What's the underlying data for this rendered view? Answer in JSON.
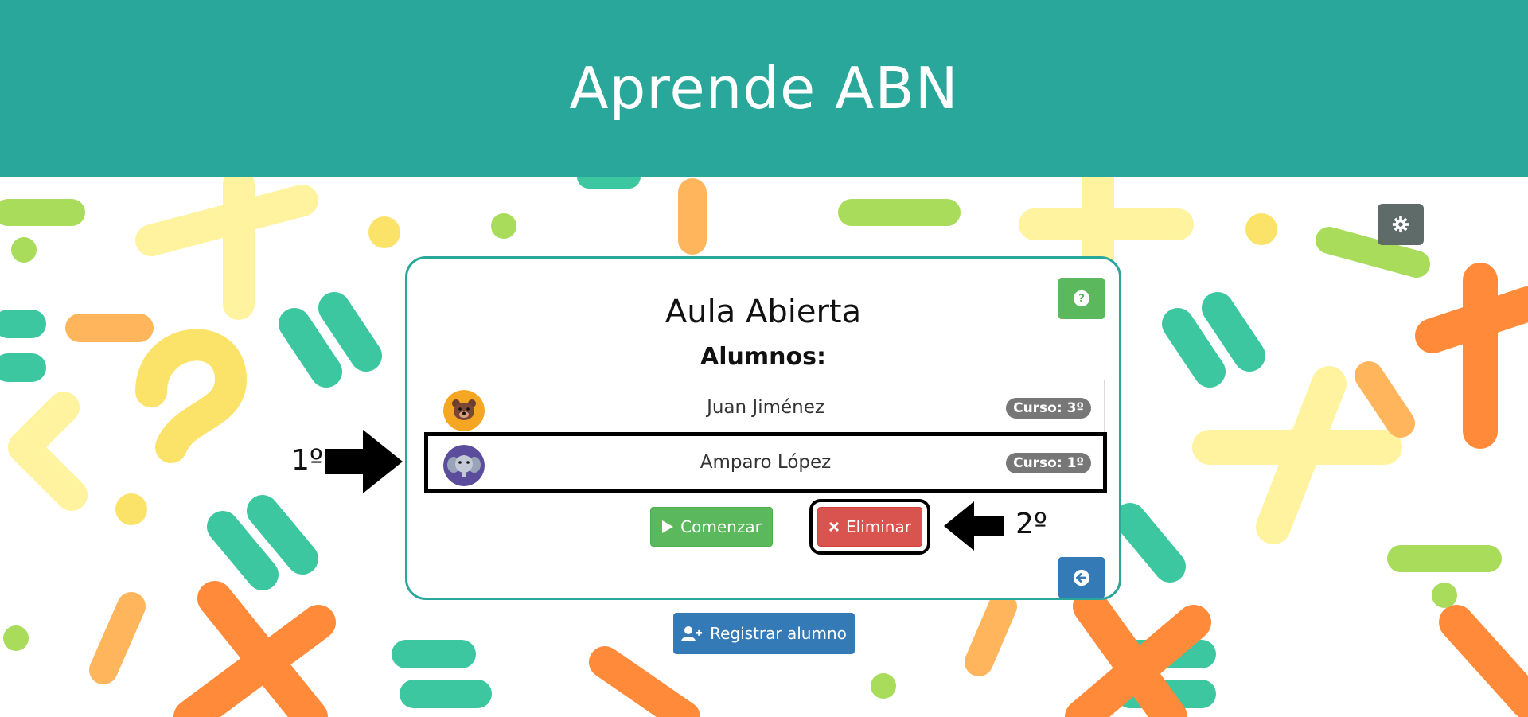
{
  "app": {
    "title": "Aprende ABN"
  },
  "card": {
    "title": "Aula Abierta",
    "subtitle": "Alumnos:"
  },
  "students": [
    {
      "name": "Juan Jiménez",
      "badge": "Curso: 3º",
      "avatar": "bear-avatar",
      "avatar_color": "#f5a623"
    },
    {
      "name": "Amparo López",
      "badge": "Curso: 1º",
      "avatar": "elephant-avatar",
      "avatar_color": "#5b4c9c",
      "selected": true
    }
  ],
  "buttons": {
    "start_label": "Comenzar",
    "delete_label": "Eliminar",
    "register_label": "Registrar alumno"
  },
  "annotations": {
    "step1": "1º",
    "step2": "2º"
  },
  "icons": {
    "settings": "gear-icon",
    "help": "question-icon",
    "back": "arrow-left-circle-icon",
    "start": "play-icon",
    "delete": "times-icon",
    "register": "user-plus-icon"
  },
  "colors": {
    "header": "#2aa79b",
    "success": "#5cb85c",
    "danger": "#d9534f",
    "primary": "#337ab7",
    "settings": "#5f6b68",
    "badge": "#777777"
  }
}
